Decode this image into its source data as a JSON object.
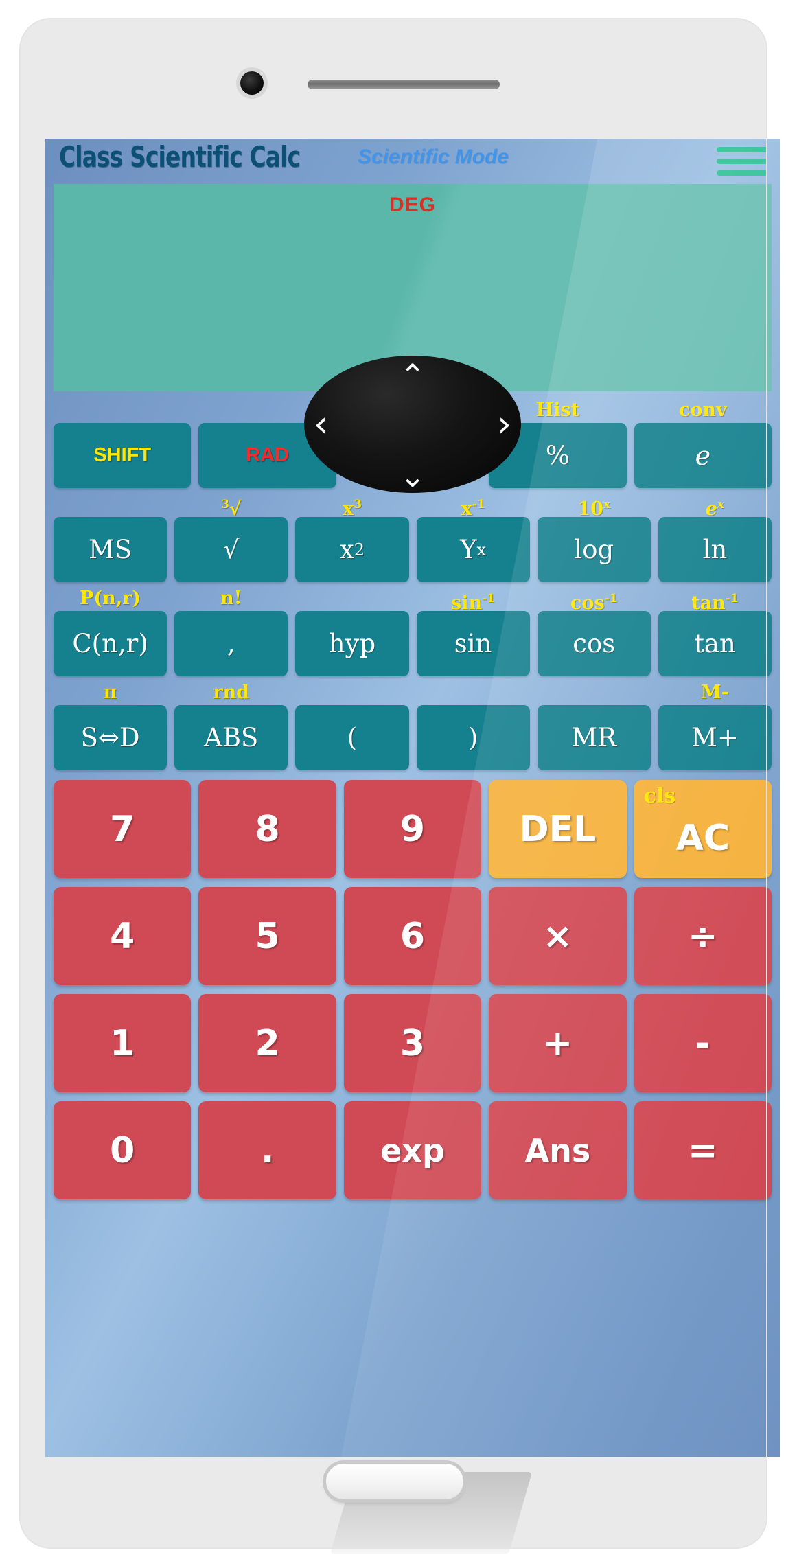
{
  "header": {
    "title": "Class Scientific Calc",
    "mode": "Scientific Mode",
    "menu_icon": "hamburger-menu-icon"
  },
  "display": {
    "angle_unit": "DEG",
    "value": "",
    "bg_color": "#5cb7ab",
    "deg_color": "#d93025"
  },
  "colors": {
    "function_button": "#15808e",
    "number_button": "#d04a55",
    "action_button": "#f5b13c",
    "shift_label": "#ffe600",
    "rad_label": "#ef2d2d",
    "menu_icon": "#2ec295",
    "title": "#0d5076",
    "mode": "#4294e8"
  },
  "dpad": {
    "up": "⌃",
    "down": "⌄",
    "left": "‹",
    "right": "›"
  },
  "function_rows": [
    {
      "keys": [
        {
          "sub": "",
          "label": "SHIFT",
          "style": "shift"
        },
        {
          "sub": "",
          "label": "RAD",
          "style": "rad"
        },
        {
          "sub": "",
          "label": "",
          "style": "dpad"
        },
        {
          "sub": "Hist",
          "label": "%",
          "style": "plain"
        },
        {
          "sub": "conv",
          "label": "e",
          "style": "script"
        }
      ]
    },
    {
      "keys": [
        {
          "sub": "",
          "label": "MS",
          "style": "plain"
        },
        {
          "sub": "3√",
          "label": "√",
          "style": "plain"
        },
        {
          "sub": "x3",
          "label": "x2",
          "style": "sup"
        },
        {
          "sub": "x-1",
          "label": "Yx",
          "style": "sup"
        },
        {
          "sub": "10x",
          "label": "log",
          "style": "plain"
        },
        {
          "sub": "ex",
          "label": "ln",
          "style": "plain"
        }
      ]
    },
    {
      "keys": [
        {
          "sub": "P(n,r)",
          "label": "C(n,r)",
          "style": "plain"
        },
        {
          "sub": "n!",
          "label": ",",
          "style": "plain"
        },
        {
          "sub": "",
          "label": "hyp",
          "style": "plain"
        },
        {
          "sub": "sin-1",
          "label": "sin",
          "style": "plain"
        },
        {
          "sub": "cos-1",
          "label": "cos",
          "style": "plain"
        },
        {
          "sub": "tan-1",
          "label": "tan",
          "style": "plain"
        }
      ]
    },
    {
      "keys": [
        {
          "sub": "π",
          "label": "S⇔D",
          "style": "plain"
        },
        {
          "sub": "rnd",
          "label": "ABS",
          "style": "plain"
        },
        {
          "sub": "",
          "label": "(",
          "style": "plain"
        },
        {
          "sub": "",
          "label": ")",
          "style": "plain"
        },
        {
          "sub": "",
          "label": "MR",
          "style": "plain"
        },
        {
          "sub": "M-",
          "label": "M+",
          "style": "plain"
        }
      ]
    }
  ],
  "subscript_labels": {
    "cube_root_index": "3",
    "cube_root_sign": "√",
    "x_cubed_base": "x",
    "x_cubed_exp": "3",
    "x_inv_base": "x",
    "x_inv_exp": "-1",
    "ten_x_base": "10",
    "ten_x_exp": "x",
    "e_x_base": "e",
    "e_x_exp": "x",
    "sin_inv_base": "sin",
    "sin_inv_exp": "-1",
    "cos_inv_base": "cos",
    "cos_inv_exp": "-1",
    "tan_inv_base": "tan",
    "tan_inv_exp": "-1"
  },
  "main_labels": {
    "x_sq_base": "x",
    "x_sq_exp": "2",
    "y_x_base": "Y",
    "y_x_exp": "x"
  },
  "number_rows": [
    [
      {
        "label": "7",
        "kind": "number"
      },
      {
        "label": "8",
        "kind": "number"
      },
      {
        "label": "9",
        "kind": "number"
      },
      {
        "label": "DEL",
        "kind": "action"
      },
      {
        "label": "AC",
        "kind": "action",
        "sub": "cls"
      }
    ],
    [
      {
        "label": "4",
        "kind": "number"
      },
      {
        "label": "5",
        "kind": "number"
      },
      {
        "label": "6",
        "kind": "number"
      },
      {
        "label": "×",
        "kind": "number"
      },
      {
        "label": "÷",
        "kind": "number"
      }
    ],
    [
      {
        "label": "1",
        "kind": "number"
      },
      {
        "label": "2",
        "kind": "number"
      },
      {
        "label": "3",
        "kind": "number"
      },
      {
        "label": "+",
        "kind": "number"
      },
      {
        "label": "-",
        "kind": "number"
      }
    ],
    [
      {
        "label": "0",
        "kind": "number"
      },
      {
        "label": ".",
        "kind": "number"
      },
      {
        "label": "exp",
        "kind": "number"
      },
      {
        "label": "Ans",
        "kind": "number"
      },
      {
        "label": "=",
        "kind": "number"
      }
    ]
  ]
}
